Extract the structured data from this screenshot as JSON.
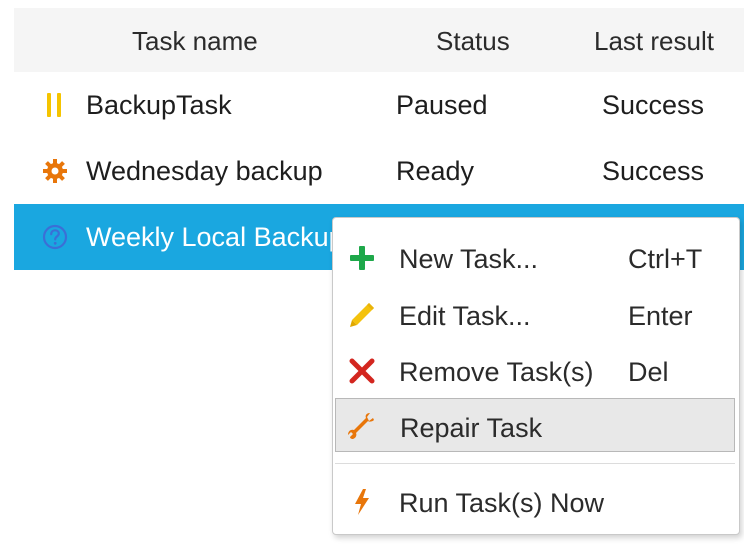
{
  "columns": {
    "name": "Task name",
    "status": "Status",
    "result": "Last result"
  },
  "rows": [
    {
      "name": "BackupTask",
      "status": "Paused",
      "result": "Success",
      "icon": "pause-icon"
    },
    {
      "name": "Wednesday backup",
      "status": "Ready",
      "result": "Success",
      "icon": "gear-icon"
    },
    {
      "name": "Weekly Local Backup",
      "status": "",
      "result": "",
      "icon": "question-icon"
    }
  ],
  "context_menu": {
    "items": [
      {
        "label": "New Task...",
        "shortcut": "Ctrl+T",
        "icon": "plus-icon"
      },
      {
        "label": "Edit Task...",
        "shortcut": "Enter",
        "icon": "pencil-icon"
      },
      {
        "label": "Remove Task(s)",
        "shortcut": "Del",
        "icon": "x-icon"
      },
      {
        "label": "Repair Task",
        "shortcut": "",
        "icon": "wrench-icon"
      },
      {
        "label": "Run Task(s) Now",
        "shortcut": "",
        "icon": "lightning-icon"
      }
    ]
  },
  "colors": {
    "selection": "#1aa7e0",
    "pause": "#f5c400",
    "gear": "#e8760a",
    "plus": "#1ea84a",
    "pencil": "#f4c20d",
    "remove": "#d3261f",
    "wrench": "#e8760a",
    "lightning": "#e8760a"
  }
}
